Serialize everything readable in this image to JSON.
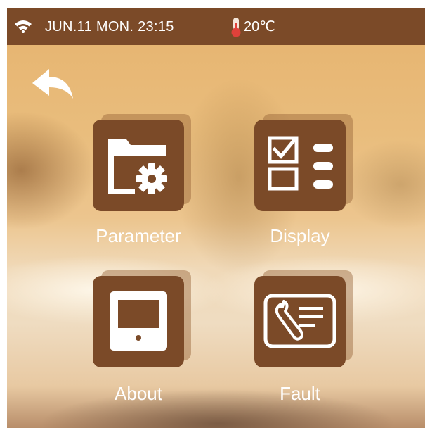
{
  "status_bar": {
    "wifi_icon": "wifi-icon",
    "date_time": "JUN.11 MON.  23:15",
    "thermometer_icon": "thermometer-icon",
    "temperature": "20℃"
  },
  "navigation": {
    "back_icon": "back-arrow-icon"
  },
  "menu": {
    "tiles": [
      {
        "label": "Parameter",
        "icon": "folder-settings-icon"
      },
      {
        "label": "Display",
        "icon": "checklist-icon"
      },
      {
        "label": "About",
        "icon": "device-icon"
      },
      {
        "label": "Fault",
        "icon": "wrench-icon"
      }
    ]
  },
  "colors": {
    "accent_brown": "#7b4a28",
    "thermometer_red": "#e0413a",
    "text": "#ffffff"
  }
}
